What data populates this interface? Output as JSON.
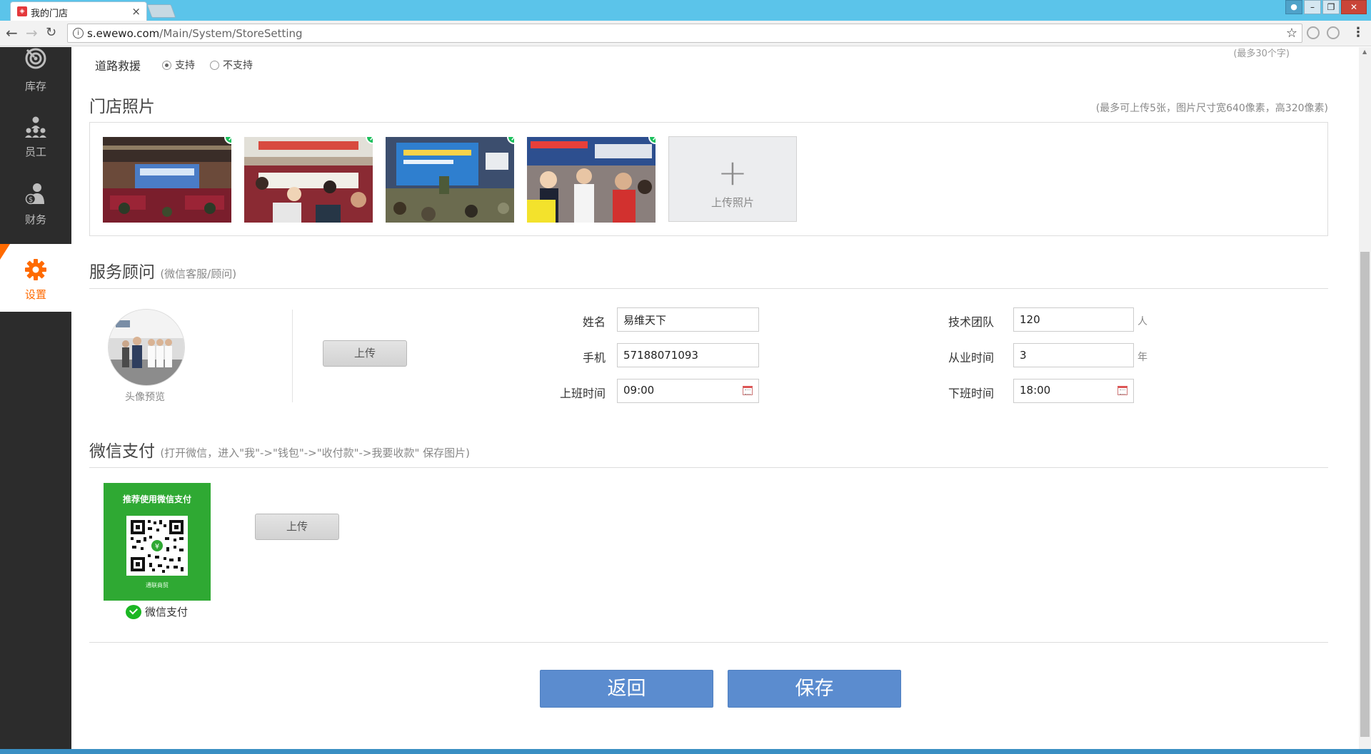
{
  "browser": {
    "tab_title": "我的门店",
    "url_host": "s.ewewo.com",
    "url_path": "/Main/System/StoreSetting"
  },
  "sidebar": {
    "items": [
      {
        "label": "库存",
        "icon": "inventory-icon"
      },
      {
        "label": "员工",
        "icon": "staff-icon"
      },
      {
        "label": "财务",
        "icon": "finance-icon"
      },
      {
        "label": "设置",
        "icon": "gear-icon",
        "active": true
      }
    ],
    "active_color": "#ff6a00"
  },
  "road_rescue": {
    "label": "道路救援",
    "options": [
      "支持",
      "不支持"
    ],
    "selected": "支持",
    "max_hint": "(最多30个字)"
  },
  "store_photos": {
    "title": "门店照片",
    "hint": "(最多可上传5张，图片尺寸宽640像素，高320像素)",
    "upload_label": "上传照片"
  },
  "advisor": {
    "title": "服务顾问",
    "subtitle": "(微信客服/顾问)",
    "avatar_label": "头像预览",
    "upload_button": "上传",
    "name_label": "姓名",
    "name_value": "易维天下",
    "phone_label": "手机",
    "phone_value": "57188071093",
    "start_label": "上班时间",
    "start_value": "09:00",
    "team_label": "技术团队",
    "team_value": "120",
    "team_unit": "人",
    "years_label": "从业时间",
    "years_value": "3",
    "years_unit": "年",
    "end_label": "下班时间",
    "end_value": "18:00"
  },
  "wechat_pay": {
    "title": "微信支付",
    "subtitle": "(打开微信，进入\"我\"->\"钱包\"->\"收付款\"->我要收款\" 保存图片)",
    "card_header": "推荐使用微信支付",
    "card_footer": "通联商贸",
    "logo_label": "微信支付",
    "upload_button": "上传",
    "brand_color": "#2fa933"
  },
  "actions": {
    "back": "返回",
    "save": "保存",
    "button_color": "#5b8ccf"
  }
}
